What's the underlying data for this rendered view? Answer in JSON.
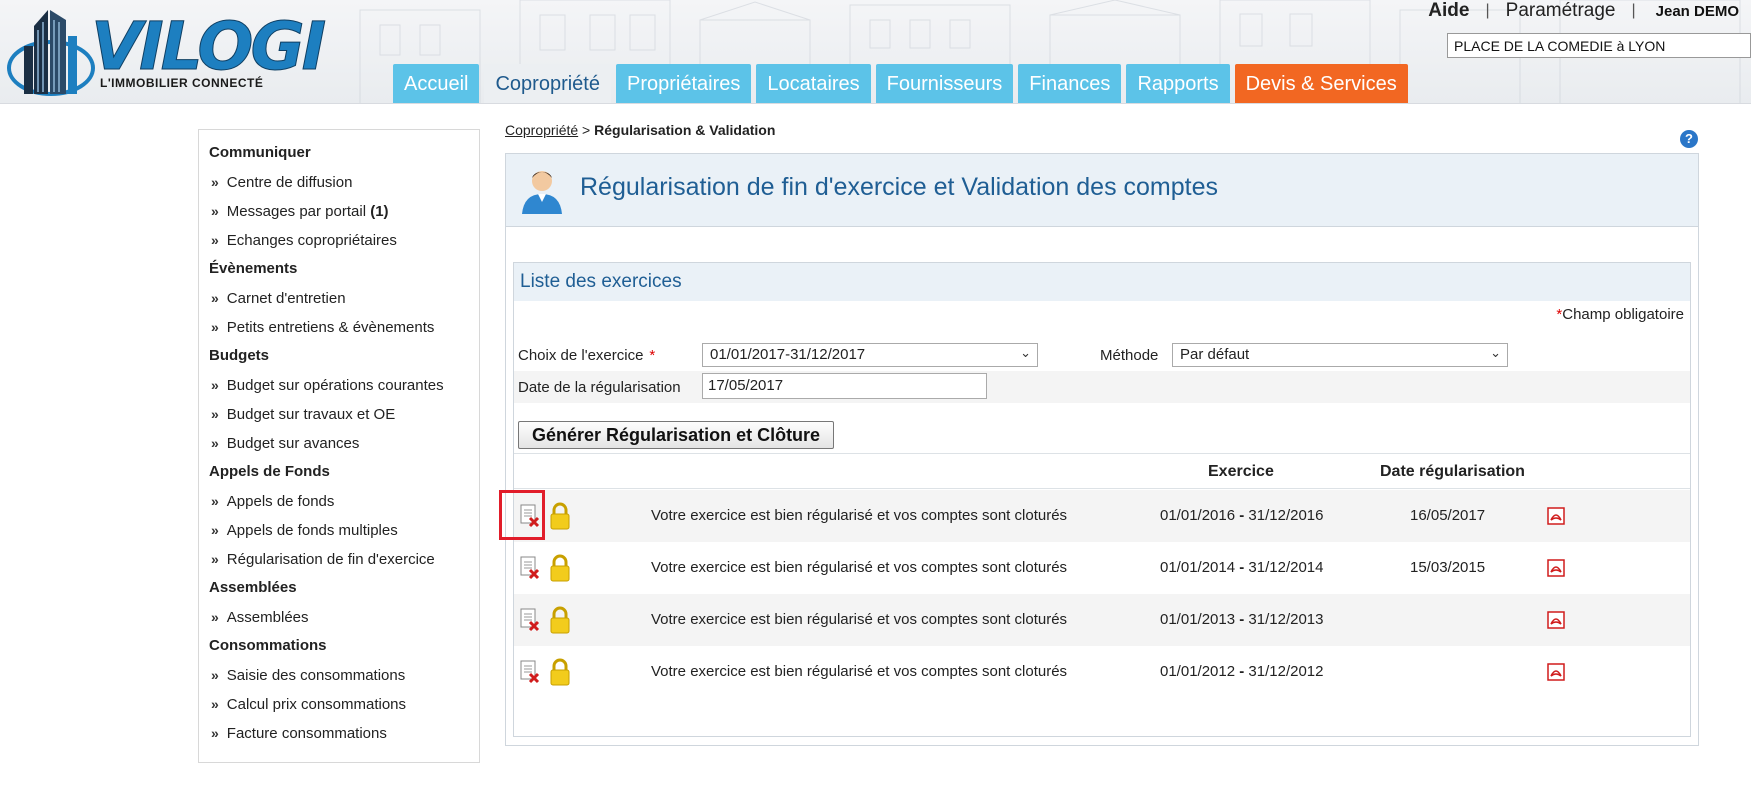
{
  "header": {
    "logo_text": "VILOGI",
    "logo_tagline": "L'IMMOBILIER CONNECTÉ",
    "help_link": "Aide",
    "settings_link": "Paramétrage",
    "separator": "|",
    "user_name": "Jean DEMO",
    "address": "PLACE DE LA COMEDIE à LYON"
  },
  "tabs": [
    {
      "label": "Accueil",
      "active": false
    },
    {
      "label": "Copropriété",
      "active": true
    },
    {
      "label": "Propriétaires",
      "active": false
    },
    {
      "label": "Locataires",
      "active": false
    },
    {
      "label": "Fournisseurs",
      "active": false
    },
    {
      "label": "Finances",
      "active": false
    },
    {
      "label": "Rapports",
      "active": false
    },
    {
      "label": "Devis & Services",
      "active": false
    }
  ],
  "sidebar": {
    "sections": [
      {
        "title": "Communiquer",
        "items": [
          {
            "label": "Centre de diffusion"
          },
          {
            "label": "Messages par portail",
            "badge": "(1)"
          },
          {
            "label": "Echanges copropriétaires"
          }
        ]
      },
      {
        "title": "Évènements",
        "items": [
          {
            "label": "Carnet d'entretien"
          },
          {
            "label": "Petits entretiens & évènements"
          }
        ]
      },
      {
        "title": "Budgets",
        "items": [
          {
            "label": "Budget sur opérations courantes"
          },
          {
            "label": "Budget sur travaux et OE"
          },
          {
            "label": "Budget sur avances"
          }
        ]
      },
      {
        "title": "Appels de Fonds",
        "items": [
          {
            "label": "Appels de fonds"
          },
          {
            "label": "Appels de fonds multiples"
          },
          {
            "label": "Régularisation de fin d'exercice"
          }
        ]
      },
      {
        "title": "Assemblées",
        "items": [
          {
            "label": "Assemblées"
          }
        ]
      },
      {
        "title": "Consommations",
        "items": [
          {
            "label": "Saisie des consommations"
          },
          {
            "label": "Calcul prix consommations"
          },
          {
            "label": "Facture consommations"
          }
        ]
      }
    ]
  },
  "breadcrumb": {
    "parent": "Copropriété",
    "separator": ">",
    "current": "Régularisation & Validation"
  },
  "main": {
    "help_icon": "?",
    "title": "Régularisation de fin d'exercice et Validation des comptes",
    "section_title": "Liste des exercices",
    "required_star": "*",
    "required_note": "Champ obligatoire",
    "form": {
      "exercice_label": "Choix de l'exercice",
      "exercice_value": "01/01/2017-31/12/2017",
      "methode_label": "Méthode",
      "methode_value": "Par défaut",
      "date_label": "Date de la régularisation",
      "date_value": "17/05/2017",
      "generate_button": "Générer Régularisation et Clôture"
    },
    "table": {
      "headers": {
        "exercice": "Exercice",
        "date": "Date régularisation"
      },
      "rows": [
        {
          "status": "Votre exercice est bien régularisé et vos comptes sont cloturés",
          "start": "01/01/2016",
          "dash": "-",
          "end": "31/12/2016",
          "date": "16/05/2017"
        },
        {
          "status": "Votre exercice est bien régularisé et vos comptes sont cloturés",
          "start": "01/01/2014",
          "dash": "-",
          "end": "31/12/2014",
          "date": "15/03/2015"
        },
        {
          "status": "Votre exercice est bien régularisé et vos comptes sont cloturés",
          "start": "01/01/2013",
          "dash": "-",
          "end": "31/12/2013",
          "date": ""
        },
        {
          "status": "Votre exercice est bien régularisé et vos comptes sont cloturés",
          "start": "01/01/2012",
          "dash": "-",
          "end": "31/12/2012",
          "date": ""
        }
      ]
    }
  },
  "icons": {
    "chevron": "⌄",
    "sidebar_arrow": "»"
  },
  "colors": {
    "tab_blue": "#5cc3e8",
    "tab_orange": "#f26722",
    "title_blue": "#1f5e94",
    "highlight_red": "#e11d2a"
  }
}
